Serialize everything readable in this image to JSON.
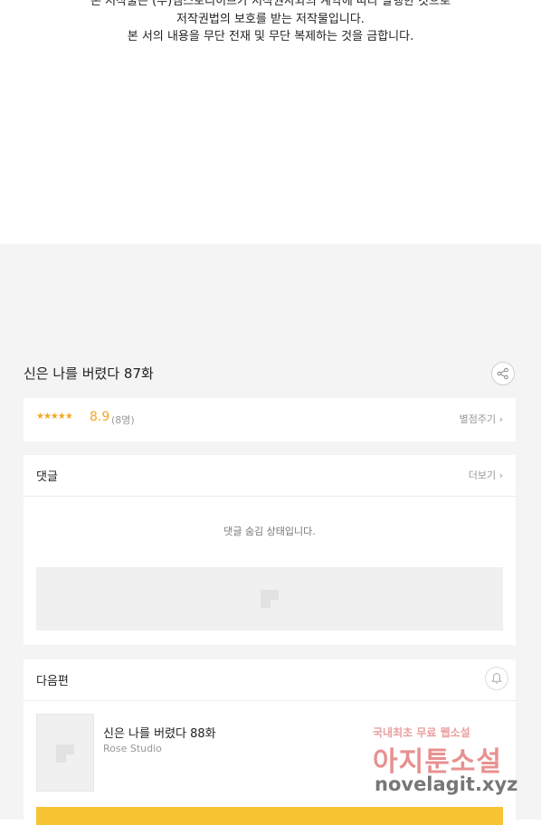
{
  "copyright": {
    "line1": "본 저작물은 (주)엠스토리허브가 저작권사와의 계약에 따라 발행한 것으로",
    "line2": "저작권법의 보호를 받는 저작물입니다.",
    "line3": "본 서의 내용을 무단 전재 및 무단 복제하는 것을 금합니다."
  },
  "episode": {
    "title": "신은 나를 버렸다 87화"
  },
  "rating": {
    "stars": "★★★★★",
    "score": "8.9",
    "count": "(8명)",
    "link": "별점주기 ›",
    "value": 8.9
  },
  "comments": {
    "header": "댓글",
    "more": "더보기 ›",
    "hidden_message": "댓글 숨김 상태입니다."
  },
  "next": {
    "header": "다음편",
    "title": "신은 나를 버렸다 88화",
    "author": "Rose Studio"
  },
  "watermark": {
    "line1": "국내최초 무료 웹소설",
    "line2": "아지툰소설",
    "line3": "novelagit.xyz"
  },
  "colors": {
    "accent": "#f8c332",
    "star": "#f5a623",
    "background": "#f4f4f5"
  },
  "icons": {
    "share": "share-icon",
    "bell": "bell-icon",
    "placeholder": "image-placeholder-icon"
  }
}
